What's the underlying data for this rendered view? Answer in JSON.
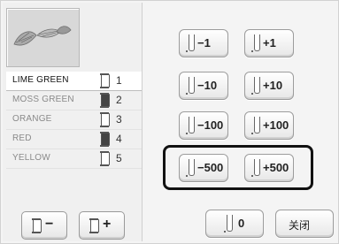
{
  "colors": [
    {
      "name": "LIME GREEN",
      "num": "1",
      "spool": "white"
    },
    {
      "name": "MOSS GREEN",
      "num": "2",
      "spool": "dark"
    },
    {
      "name": "ORANGE",
      "num": "3",
      "spool": "white"
    },
    {
      "name": "RED",
      "num": "4",
      "spool": "dark"
    },
    {
      "name": "YELLOW",
      "num": "5",
      "spool": "white"
    }
  ],
  "selected_color_index": 0,
  "stitch_buttons": {
    "minus": "−",
    "plus": "+"
  },
  "needle_buttons": {
    "m1": "−1",
    "p1": "+1",
    "m10": "−10",
    "p10": "+10",
    "m100": "−100",
    "p100": "+100",
    "m500": "−500",
    "p500": "+500",
    "zero": "0"
  },
  "close_label": "关闭"
}
